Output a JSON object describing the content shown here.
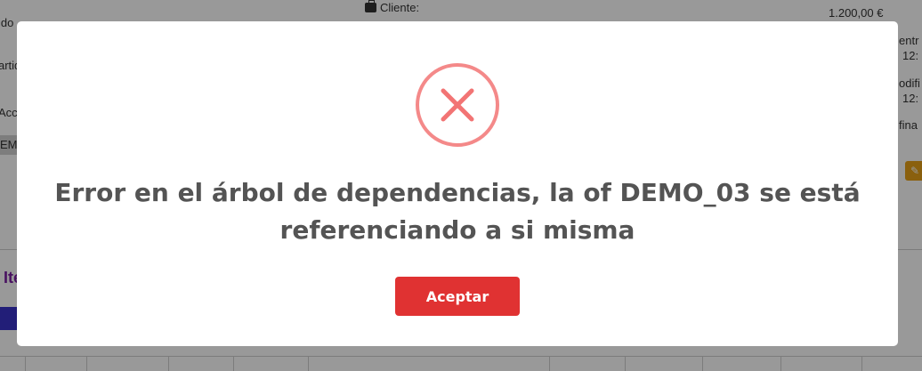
{
  "background": {
    "left_fragments": [
      "ido",
      "artid",
      "Acc",
      "EM",
      "Ite"
    ],
    "client_label": "Cliente:",
    "client_value": "",
    "amount": "1.200,00 €",
    "right_fragments": [
      "entr",
      "12:",
      "odifi",
      "12:",
      "fina"
    ]
  },
  "dialog": {
    "icon": "error-x-circle-icon",
    "message": "Error en el árbol de dependencias, la of DEMO_03 se está referenciando a si misma",
    "confirm_label": "Aceptar"
  },
  "colors": {
    "error": "#f27474",
    "confirm_button": "#e03232",
    "text": "#545454",
    "overlay": "rgba(0,0,0,0.4)"
  }
}
